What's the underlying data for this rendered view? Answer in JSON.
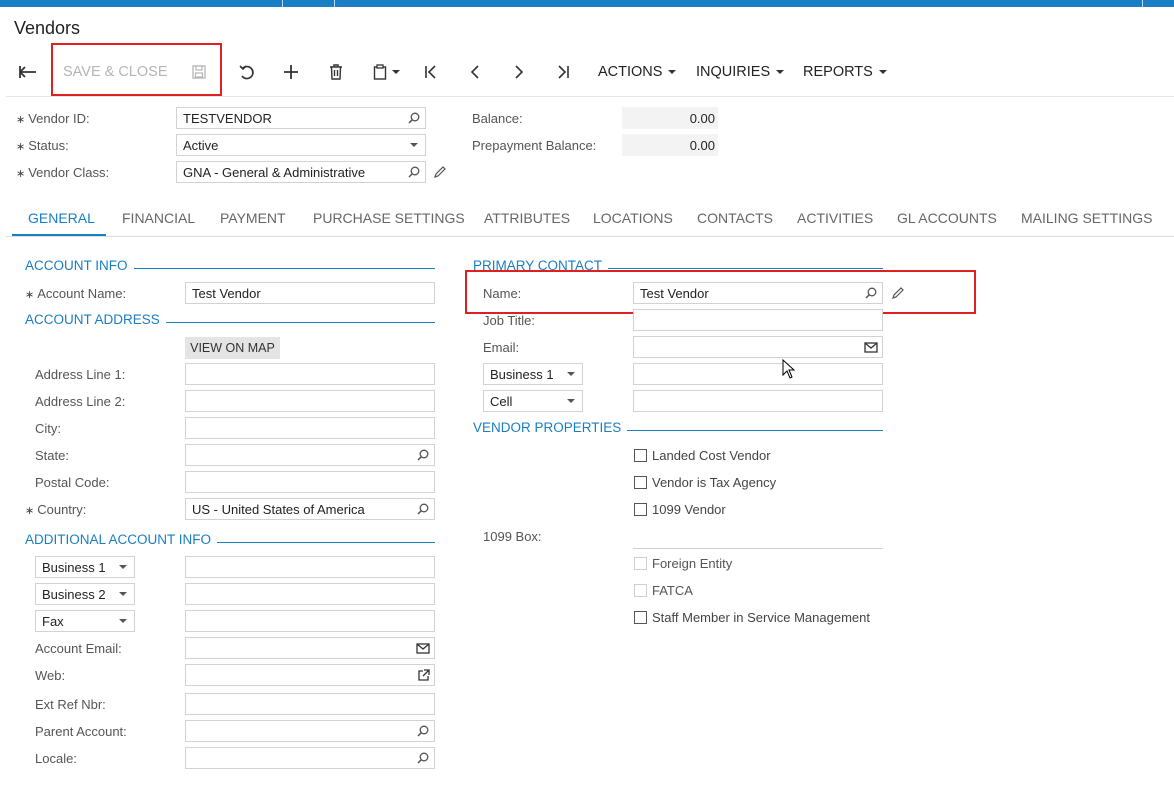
{
  "window": {
    "title": "Vendors"
  },
  "toolbar": {
    "save_close_label": "SAVE & CLOSE",
    "actions_label": "ACTIONS",
    "inquiries_label": "INQUIRIES",
    "reports_label": "REPORTS"
  },
  "summary": {
    "vendor_id": {
      "label": "Vendor ID:",
      "value": "TESTVENDOR"
    },
    "status": {
      "label": "Status:",
      "value": "Active"
    },
    "vendor_class": {
      "label": "Vendor Class:",
      "value": "GNA - General & Administrative"
    },
    "balance": {
      "label": "Balance:",
      "value": "0.00"
    },
    "prepayment_balance": {
      "label": "Prepayment Balance:",
      "value": "0.00"
    }
  },
  "tabs": [
    {
      "label": "GENERAL"
    },
    {
      "label": "FINANCIAL"
    },
    {
      "label": "PAYMENT"
    },
    {
      "label": "PURCHASE SETTINGS"
    },
    {
      "label": "ATTRIBUTES"
    },
    {
      "label": "LOCATIONS"
    },
    {
      "label": "CONTACTS"
    },
    {
      "label": "ACTIVITIES"
    },
    {
      "label": "GL ACCOUNTS"
    },
    {
      "label": "MAILING SETTINGS"
    }
  ],
  "account_info": {
    "section": "ACCOUNT INFO",
    "account_name": {
      "label": "Account Name:",
      "value": "Test Vendor"
    }
  },
  "account_address": {
    "section": "ACCOUNT ADDRESS",
    "view_on_map": "VIEW ON MAP",
    "address_line1": {
      "label": "Address Line 1:",
      "value": ""
    },
    "address_line2": {
      "label": "Address Line 2:",
      "value": ""
    },
    "city": {
      "label": "City:",
      "value": ""
    },
    "state": {
      "label": "State:",
      "value": ""
    },
    "postal_code": {
      "label": "Postal Code:",
      "value": ""
    },
    "country": {
      "label": "Country:",
      "value": "US - United States of America"
    }
  },
  "additional_info": {
    "section": "ADDITIONAL ACCOUNT INFO",
    "phone1_type": "Business 1",
    "phone2_type": "Business 2",
    "fax_type": "Fax",
    "account_email": {
      "label": "Account Email:",
      "value": ""
    },
    "web": {
      "label": "Web:",
      "value": ""
    },
    "ext_ref_nbr": {
      "label": "Ext Ref Nbr:",
      "value": ""
    },
    "parent_account": {
      "label": "Parent Account:",
      "value": ""
    },
    "locale": {
      "label": "Locale:",
      "value": ""
    }
  },
  "primary_contact": {
    "section": "PRIMARY CONTACT",
    "name": {
      "label": "Name:",
      "value": "Test Vendor"
    },
    "job_title": {
      "label": "Job Title:",
      "value": ""
    },
    "email": {
      "label": "Email:",
      "value": ""
    },
    "phone1_type": "Business 1",
    "phone2_type": "Cell"
  },
  "vendor_properties": {
    "section": "VENDOR PROPERTIES",
    "landed_cost_vendor": "Landed Cost Vendor",
    "tax_agency": "Vendor is Tax Agency",
    "vendor_1099": "1099 Vendor",
    "box_1099_label": "1099 Box:",
    "foreign_entity": "Foreign Entity",
    "fatca": "FATCA",
    "staff_member": "Staff Member in Service Management"
  },
  "colors": {
    "accent": "#1a7ec4",
    "highlight": "#e02020"
  }
}
